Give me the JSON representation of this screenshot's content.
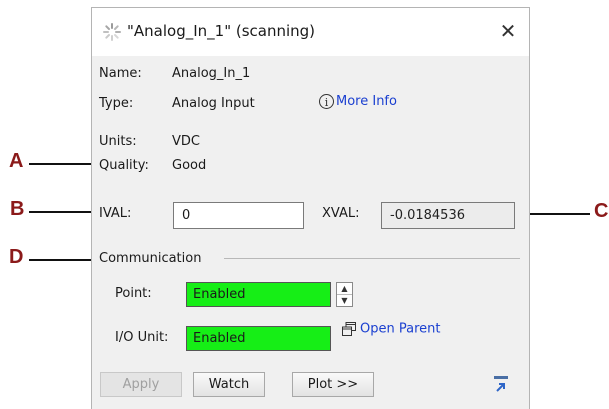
{
  "title": "\"Analog_In_1\" (scanning)",
  "close_glyph": "✕",
  "fields": [
    {
      "label": "Name:",
      "value": "Analog_In_1"
    },
    {
      "label": "Type:",
      "value": "Analog Input"
    },
    {
      "label": "Units:",
      "value": "VDC"
    },
    {
      "label": "Quality:",
      "value": "Good"
    }
  ],
  "more_info": "More Info",
  "ival": {
    "label": "IVAL:",
    "value": "0"
  },
  "xval": {
    "label": "XVAL:",
    "value": "-0.0184536"
  },
  "communication": {
    "heading": "Communication",
    "point_label": "Point:",
    "point_status": "Enabled",
    "io_label": "I/O Unit:",
    "io_status": "Enabled",
    "open_parent": "Open Parent"
  },
  "buttons": {
    "apply": "Apply",
    "watch": "Watch",
    "plot": "Plot >>"
  },
  "callouts": [
    "A",
    "B",
    "C",
    "D"
  ],
  "colors": {
    "status_green": "#16ee16",
    "link_blue": "#1a3fd0",
    "callout_red": "#8b1a1a"
  }
}
